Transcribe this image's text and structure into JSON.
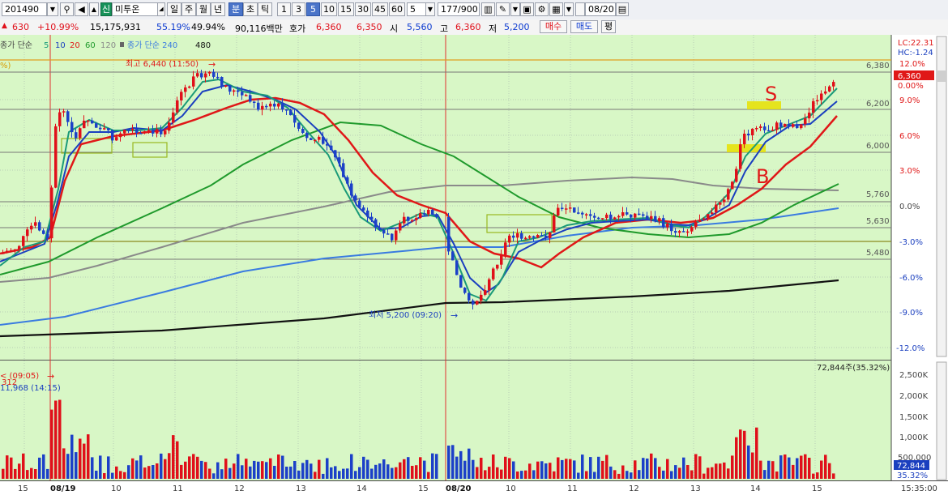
{
  "toolbar": {
    "code": "201490",
    "credit_badge": "신",
    "stock_name": "미투온",
    "periods": [
      "일",
      "주",
      "월",
      "년",
      "분",
      "초",
      "틱"
    ],
    "selected_period": "분",
    "intervals": [
      "1",
      "3",
      "5",
      "10",
      "15",
      "30",
      "45",
      "60"
    ],
    "selected_interval": "5",
    "interval_input": "5",
    "page_counter": "177/900",
    "date_input": "08/20"
  },
  "quote": {
    "change": "630",
    "change_pct": "+10.99%",
    "volume": "15,175,931",
    "ratio1": "55.19%",
    "ratio2": "49.94%",
    "amount": "90,116백만",
    "ask_label": "호가",
    "ask1": "6,360",
    "ask2": "6,350",
    "open_label": "시",
    "open": "5,560",
    "high_label": "고",
    "high": "6,360",
    "low_label": "저",
    "low": "5,200",
    "buy": "매수",
    "sell": "매도",
    "eval": "평"
  },
  "legend": {
    "ma_label": "종가 단순",
    "periods": [
      "5",
      "10",
      "20",
      "60",
      "120"
    ],
    "ma240_label": "종가 단순 240",
    "ma480": "480",
    "pct_marker": "%)"
  },
  "colors": {
    "bg": "#d8f7c6",
    "up": "#e0101a",
    "down": "#1c40c8",
    "ma5": "#1a9a78",
    "ma10": "#1a3fbf",
    "ma20": "#e01818",
    "ma60": "#1f9a2c",
    "ma120": "#8a8a8a",
    "ma240": "#3a7be0",
    "ma480": "#111111"
  },
  "price_axis": {
    "lc": "LC:22.31",
    "hc": "HC:-1.24",
    "pct_labels": [
      "12.0%",
      "9.0%",
      "6.0%",
      "3.0%",
      "0.0%",
      "-3.0%",
      "-6.0%",
      "-9.0%",
      "-12.0%"
    ],
    "current_price": "6,360",
    "current_pct": "0.00%"
  },
  "levels": [
    "6,380",
    "6,200",
    "6,000",
    "5,760",
    "5,630",
    "5,480"
  ],
  "annotations": {
    "high_text": "최고 6,440 (11:50)",
    "low_text": "최저 5,200 (09:20)",
    "s_mark": "S",
    "b_mark": "B"
  },
  "volume": {
    "current_label": "72,844주(35.32%)",
    "axis_labels": [
      "2,500K",
      "2,000K",
      "1,500K",
      "1,000K",
      "500,000"
    ],
    "current_value": "72,844",
    "current_pct": "35.32%",
    "note1": "< (09:05)",
    "note1b": "312",
    "note2": "11,968 (14:15)"
  },
  "time_axis": {
    "labels": [
      "15",
      "08/19",
      "10",
      "11",
      "12",
      "13",
      "14",
      "15",
      "08/20",
      "10",
      "11",
      "12",
      "13",
      "14",
      "15"
    ],
    "clock": "15:35:00"
  },
  "chart_data": {
    "type": "candlestick",
    "session1_date": "08/19",
    "session2_date": "08/20",
    "price_levels": [
      6380,
      6200,
      6000,
      5760,
      5630,
      5480
    ],
    "price_high": 6440,
    "price_low": 5200,
    "last_price": 6360,
    "pct_range": [
      -12.0,
      12.0
    ]
  }
}
